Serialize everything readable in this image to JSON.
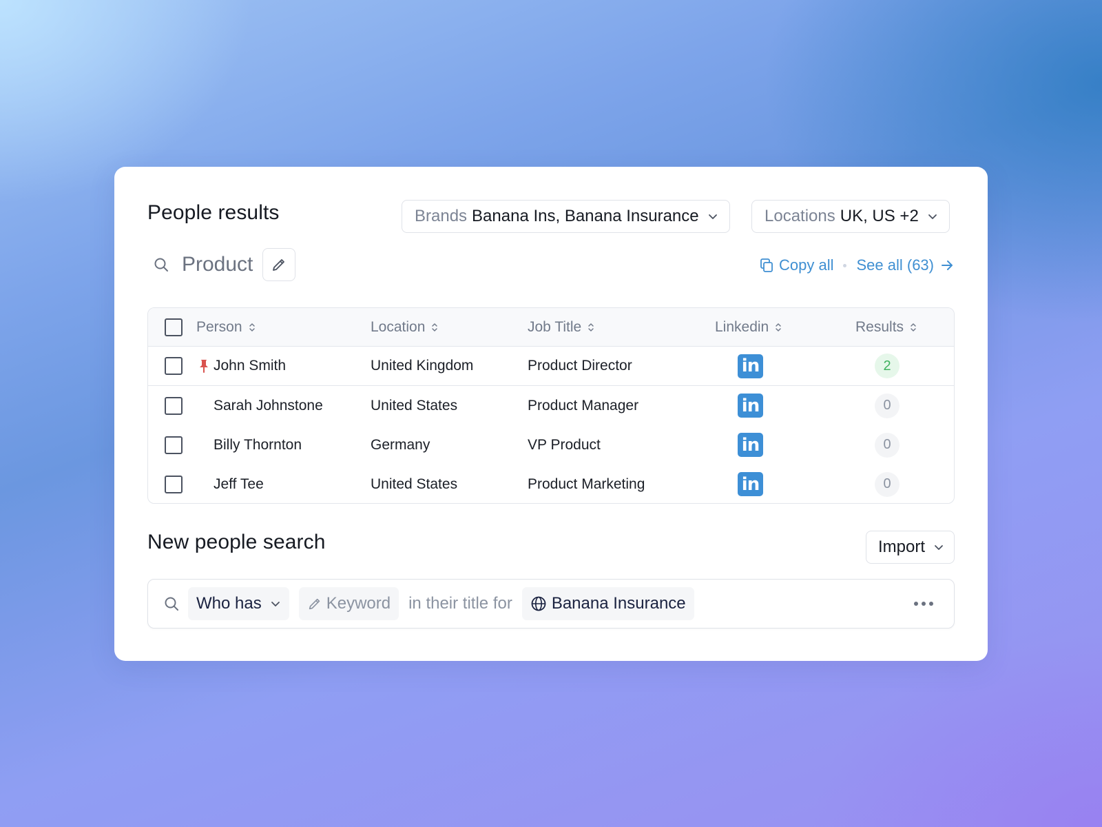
{
  "results": {
    "title": "People results",
    "brands_filter": {
      "key": "Brands",
      "value": "Banana Ins, Banana Insurance"
    },
    "locations_filter": {
      "key": "Locations",
      "value": "UK, US +2"
    },
    "query": "Product",
    "copy_all": "Copy all",
    "see_all": "See all (63)",
    "columns": [
      "Person",
      "Location",
      "Job Title",
      "Linkedin",
      "Results"
    ],
    "rows": [
      {
        "person": "John Smith",
        "location": "United Kingdom",
        "job_title": "Product Director",
        "results": "2",
        "pinned": true
      },
      {
        "person": "Sarah Johnstone",
        "location": "United States",
        "job_title": "Product Manager",
        "results": "0",
        "pinned": false
      },
      {
        "person": "Billy Thornton",
        "location": "Germany",
        "job_title": "VP Product",
        "results": "0",
        "pinned": false
      },
      {
        "person": "Jeff Tee",
        "location": "United States",
        "job_title": "Product Marketing",
        "results": "0",
        "pinned": false
      }
    ],
    "linkedin_glyph": "in"
  },
  "new_search": {
    "title": "New people search",
    "import_label": "Import",
    "who_has": "Who has",
    "keyword_placeholder": "Keyword",
    "connector": "in their title for",
    "company": "Banana Insurance"
  },
  "icons": [
    "search-icon",
    "pencil-icon",
    "copy-icon",
    "arrow-right-icon",
    "chevron-down-icon",
    "sort-icon",
    "pin-icon",
    "linkedin-icon",
    "globe-icon",
    "more-icon"
  ],
  "colors": {
    "accent": "#3f8fd2",
    "linkedin": "#3d8fd6",
    "positive": "#3fb25f",
    "pin": "#d9534f"
  }
}
